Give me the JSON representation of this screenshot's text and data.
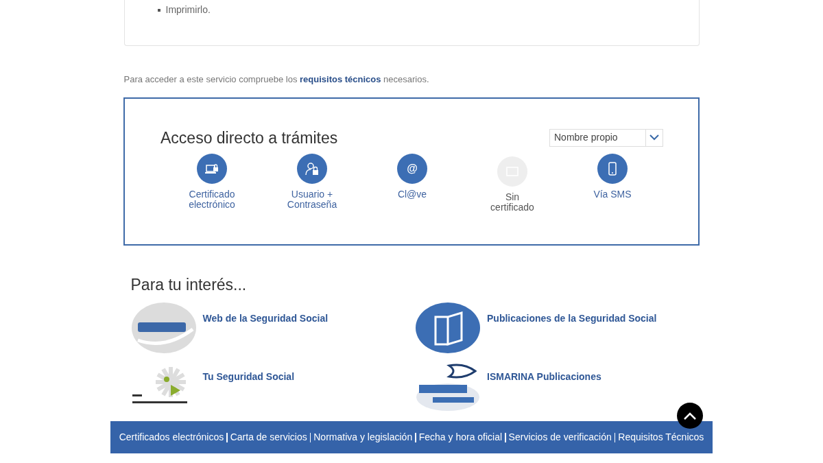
{
  "list_items": [
    "Imprimirlo."
  ],
  "requirements_note": "Para acceder a este servicio compruebe los **requisitos técnicos** necesarios.",
  "access_panel": {
    "title": "Acceso directo a trámites",
    "select": {
      "value": "Nombre propio"
    },
    "methods": [
      {
        "kind": "certificate",
        "label": "Certificado electrónico",
        "disabled": false
      },
      {
        "kind": "user",
        "label": "Usuario + Contraseña",
        "disabled": false
      },
      {
        "kind": "at",
        "icon_text": "@",
        "label": "Cl@ve",
        "disabled": false
      },
      {
        "kind": "screen",
        "label": "Sin certificado",
        "disabled": true
      },
      {
        "kind": "phone",
        "label": "Vía SMS",
        "disabled": false
      }
    ]
  },
  "interest": {
    "title": "Para tu interés...",
    "links": [
      {
        "kind": "web",
        "label": "Web de la Seguridad Social"
      },
      {
        "kind": "book",
        "label": "Publicaciones de la Seguridad Social"
      },
      {
        "kind": "star",
        "label": "Tu Seguridad Social"
      },
      {
        "kind": "fish",
        "label": "ISMARINA Publicaciones"
      }
    ]
  },
  "footer_links": [
    "Certificados electrónicos",
    "Carta de servicios",
    "Normativa y legislación",
    "Fecha y hora oficial",
    "Servicios de verificación",
    "Requisitos Técnicos"
  ]
}
